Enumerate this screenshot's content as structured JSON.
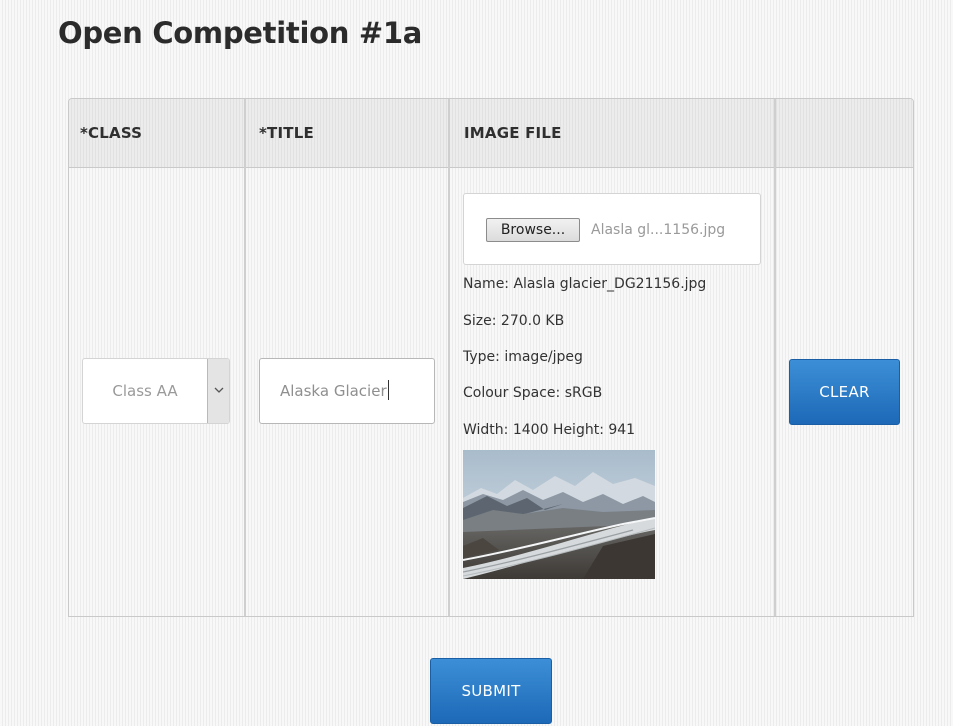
{
  "page": {
    "title": "Open Competition #1a"
  },
  "table": {
    "headers": [
      "*CLASS",
      "*TITLE",
      "IMAGE FILE",
      ""
    ]
  },
  "entry": {
    "class_select": {
      "selected": "Class AA",
      "icon": "chevron-down-icon"
    },
    "title_input": {
      "value": "Alaska Glacier"
    },
    "file": {
      "browse_label": "Browse...",
      "chosen_display": "Alasla gl...1156.jpg",
      "info": {
        "name": "Name: Alasla glacier_DG21156.jpg",
        "size": "Size: 270.0 KB",
        "type": "Type: image/jpeg",
        "colour_space": "Colour Space: sRGB",
        "dimensions": "Width: 1400 Height: 941"
      },
      "thumbnail": "glacier-image"
    },
    "clear_label": "CLEAR"
  },
  "actions": {
    "submit_label": "SUBMIT"
  },
  "colors": {
    "button_blue": "#2a7cc8",
    "header_bg": "#e9e9e9"
  }
}
